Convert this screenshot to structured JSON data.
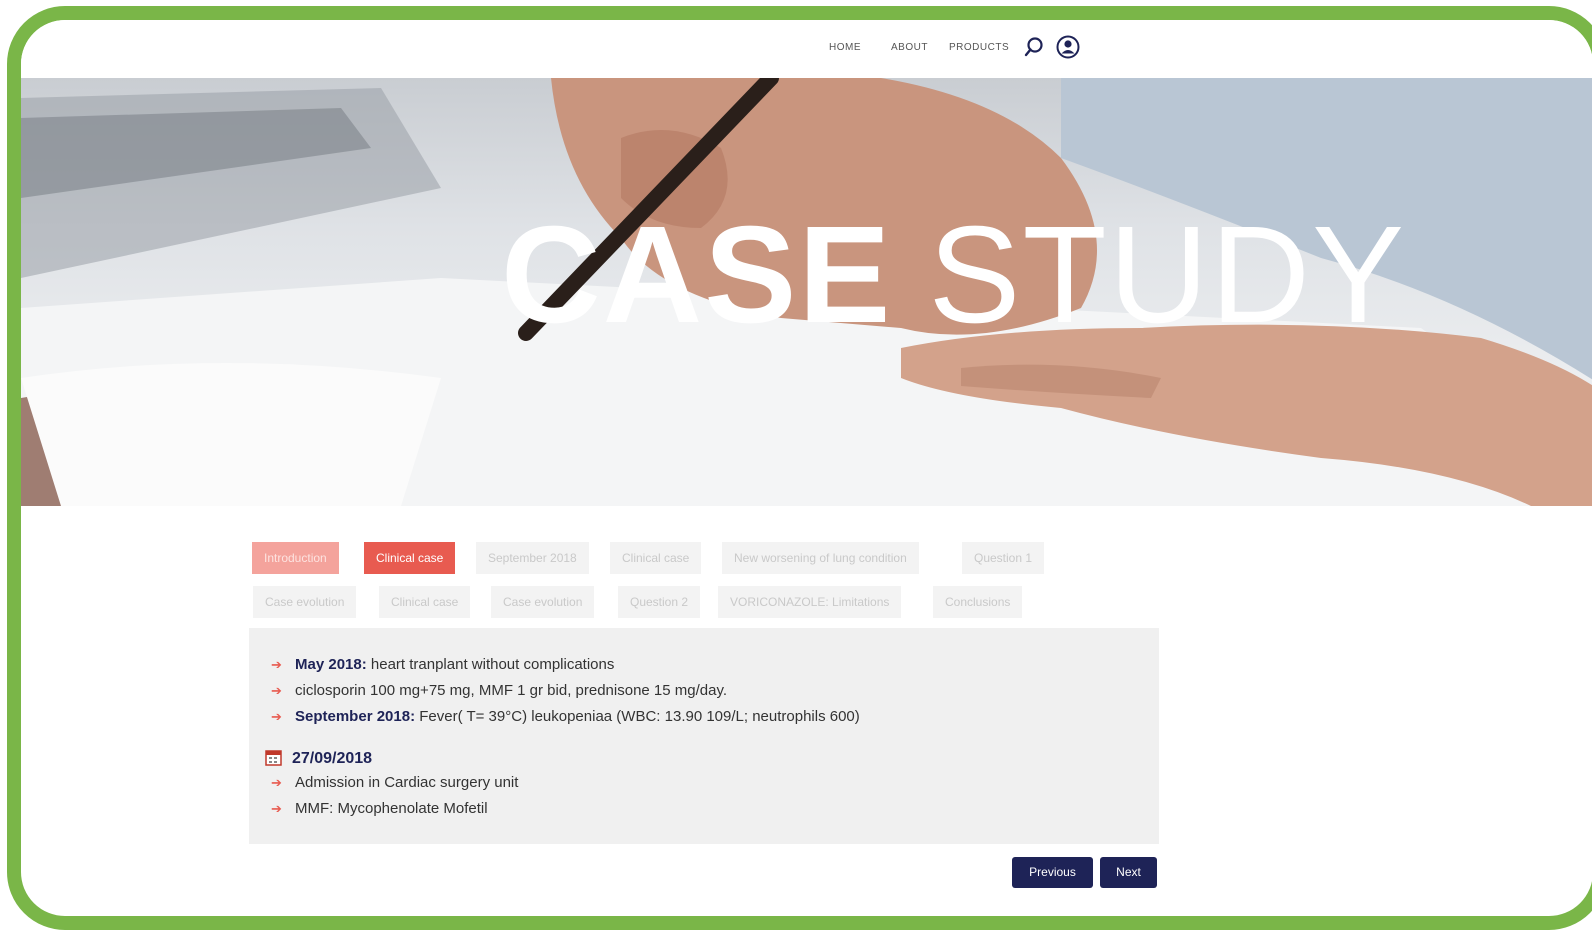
{
  "nav": {
    "links": [
      "HOME",
      "ABOUT",
      "PRODUCTS"
    ],
    "icons": [
      "search-icon",
      "user-account-icon"
    ]
  },
  "hero": {
    "title_bold": "CASE",
    "title_light": "STUDY"
  },
  "tabs": [
    {
      "label": "Introduction",
      "state": "visited"
    },
    {
      "label": "Clinical case",
      "state": "active"
    },
    {
      "label": "September 2018",
      "state": "inactive"
    },
    {
      "label": "Clinical case",
      "state": "inactive"
    },
    {
      "label": "New worsening of lung condition",
      "state": "inactive"
    },
    {
      "label": "Question 1",
      "state": "inactive"
    },
    {
      "label": "Case evolution",
      "state": "inactive"
    },
    {
      "label": "Clinical case",
      "state": "inactive"
    },
    {
      "label": "Case evolution",
      "state": "inactive"
    },
    {
      "label": "Question 2",
      "state": "inactive"
    },
    {
      "label": "VORICONAZOLE: Limitations",
      "state": "inactive"
    },
    {
      "label": "Conclusions",
      "state": "inactive"
    }
  ],
  "content": {
    "items": [
      {
        "bold": "May 2018:",
        "text": " heart tranplant without complications"
      },
      {
        "bold": "",
        "text": "ciclosporin 100 mg+75 mg, MMF 1 gr bid, prednisone 15 mg/day."
      },
      {
        "bold": "September 2018:",
        "text": " Fever( T= 39°C) leukopeniaa (WBC: 13.90 109/L; neutrophils 600)"
      }
    ],
    "date": "27/09/2018",
    "date_items": [
      "Admission in Cardiac surgery unit",
      "MMF: Mycophenolate Mofetil"
    ]
  },
  "buttons": {
    "previous": "Previous",
    "next": "Next"
  },
  "colors": {
    "frame": "#7ab648",
    "accent": "#e85b50",
    "accent_light": "#f4a39c",
    "navy": "#1e2357"
  }
}
